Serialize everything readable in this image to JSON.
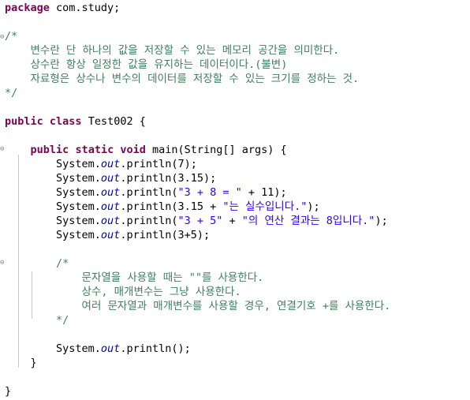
{
  "editor": {
    "lines": [
      {
        "id": "pkg",
        "tokens": [
          {
            "t": "package",
            "c": "kw"
          },
          {
            "t": " com.study;",
            "c": ""
          }
        ]
      },
      {
        "id": "doc-open",
        "tokens": [
          {
            "t": "/*",
            "c": "cm"
          }
        ]
      },
      {
        "id": "doc-1",
        "tokens": [
          {
            "t": "    변수란 단 하나의 값을 저장할 수 있는 메모리 공간을 의미한다.",
            "c": "cm"
          }
        ]
      },
      {
        "id": "doc-2",
        "tokens": [
          {
            "t": "    상수란 항상 일정한 값을 유지하는 데이터이다.(불변)",
            "c": "cm"
          }
        ]
      },
      {
        "id": "doc-3",
        "tokens": [
          {
            "t": "    자료형은 상수나 변수의 데이터를 저장할 수 있는 크기를 정하는 것.",
            "c": "cm"
          }
        ]
      },
      {
        "id": "doc-close",
        "tokens": [
          {
            "t": "*/",
            "c": "cm"
          }
        ]
      },
      {
        "id": "class-decl",
        "tokens": [
          {
            "t": "public",
            "c": "kw"
          },
          {
            "t": " ",
            "c": ""
          },
          {
            "t": "class",
            "c": "kw"
          },
          {
            "t": " Test002 {",
            "c": ""
          }
        ]
      },
      {
        "id": "main-decl",
        "tokens": [
          {
            "t": "    ",
            "c": ""
          },
          {
            "t": "public",
            "c": "kw"
          },
          {
            "t": " ",
            "c": ""
          },
          {
            "t": "static",
            "c": "kw"
          },
          {
            "t": " ",
            "c": ""
          },
          {
            "t": "void",
            "c": "kw"
          },
          {
            "t": " main(String[] args) {",
            "c": ""
          }
        ]
      },
      {
        "id": "print-1",
        "tokens": [
          {
            "t": "        System.",
            "c": ""
          },
          {
            "t": "out",
            "c": "fld"
          },
          {
            "t": ".println(7);",
            "c": ""
          }
        ]
      },
      {
        "id": "print-2",
        "tokens": [
          {
            "t": "        System.",
            "c": ""
          },
          {
            "t": "out",
            "c": "fld"
          },
          {
            "t": ".println(3.15);",
            "c": ""
          }
        ]
      },
      {
        "id": "print-3",
        "tokens": [
          {
            "t": "        System.",
            "c": ""
          },
          {
            "t": "out",
            "c": "fld"
          },
          {
            "t": ".println(",
            "c": ""
          },
          {
            "t": "\"3 + 8 = \"",
            "c": "st"
          },
          {
            "t": " + 11);",
            "c": ""
          }
        ]
      },
      {
        "id": "print-4",
        "tokens": [
          {
            "t": "        System.",
            "c": ""
          },
          {
            "t": "out",
            "c": "fld"
          },
          {
            "t": ".println(3.15 + ",
            "c": ""
          },
          {
            "t": "\"는 실수입니다.\"",
            "c": "st"
          },
          {
            "t": ");",
            "c": ""
          }
        ]
      },
      {
        "id": "print-5",
        "tokens": [
          {
            "t": "        System.",
            "c": ""
          },
          {
            "t": "out",
            "c": "fld"
          },
          {
            "t": ".println(",
            "c": ""
          },
          {
            "t": "\"3 + 5\"",
            "c": "st"
          },
          {
            "t": " + ",
            "c": ""
          },
          {
            "t": "\"의 연산 결과는 8입니다.\"",
            "c": "st"
          },
          {
            "t": ");",
            "c": ""
          }
        ]
      },
      {
        "id": "print-6",
        "tokens": [
          {
            "t": "        System.",
            "c": ""
          },
          {
            "t": "out",
            "c": "fld"
          },
          {
            "t": ".println(3+5);",
            "c": ""
          }
        ]
      },
      {
        "id": "cm2-open",
        "tokens": [
          {
            "t": "        /*",
            "c": "cm"
          }
        ]
      },
      {
        "id": "cm2-1",
        "tokens": [
          {
            "t": "            문자열을 사용할 때는 \"\"를 사용한다.",
            "c": "cm"
          }
        ]
      },
      {
        "id": "cm2-2",
        "tokens": [
          {
            "t": "            상수, 매개변수는 그냥 사용한다.",
            "c": "cm"
          }
        ]
      },
      {
        "id": "cm2-3",
        "tokens": [
          {
            "t": "            여러 문자열과 매개변수를 사용할 경우, 연결기호 +를 사용한다.",
            "c": "cm"
          }
        ]
      },
      {
        "id": "cm2-close",
        "tokens": [
          {
            "t": "        */",
            "c": "cm"
          }
        ]
      },
      {
        "id": "print-7",
        "tokens": [
          {
            "t": "        System.",
            "c": ""
          },
          {
            "t": "out",
            "c": "fld"
          },
          {
            "t": ".println();",
            "c": ""
          }
        ]
      },
      {
        "id": "main-close",
        "tokens": [
          {
            "t": "    }",
            "c": ""
          }
        ]
      },
      {
        "id": "class-close",
        "tokens": [
          {
            "t": "}",
            "c": ""
          }
        ]
      }
    ],
    "fold_marker": "⊖"
  }
}
